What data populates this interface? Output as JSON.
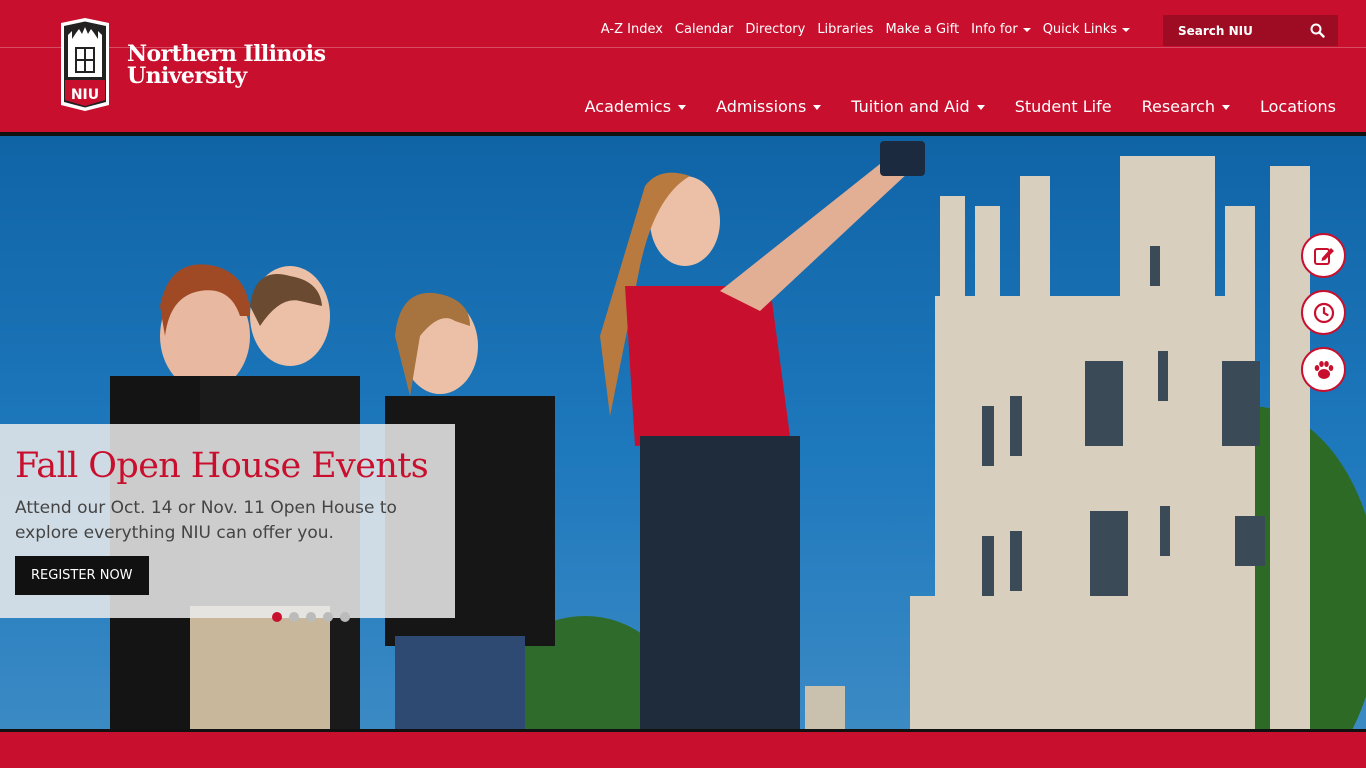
{
  "branding": {
    "shield_text": "NIU",
    "name_line1": "Northern Illinois",
    "name_line2": "University"
  },
  "utility_nav": [
    {
      "label": "A-Z Index"
    },
    {
      "label": "Calendar"
    },
    {
      "label": "Directory"
    },
    {
      "label": "Libraries"
    },
    {
      "label": "Make a Gift"
    },
    {
      "label": "Info for",
      "dropdown": true
    },
    {
      "label": "Quick Links",
      "dropdown": true
    }
  ],
  "search": {
    "label": "Search NIU"
  },
  "main_nav": [
    {
      "label": "Academics",
      "dropdown": true
    },
    {
      "label": "Admissions",
      "dropdown": true
    },
    {
      "label": "Tuition and Aid",
      "dropdown": true
    },
    {
      "label": "Student Life",
      "dropdown": false
    },
    {
      "label": "Research",
      "dropdown": true
    },
    {
      "label": "Locations",
      "dropdown": false
    }
  ],
  "hero": {
    "title": "Fall Open House Events",
    "text": "Attend our Oct. 14 or Nov. 11 Open House to explore everything NIU can offer you.",
    "button": "REGISTER NOW",
    "slides_total": 5,
    "active_slide": 1
  },
  "side_buttons": [
    {
      "icon": "edit-icon"
    },
    {
      "icon": "clock-icon"
    },
    {
      "icon": "paw-icon"
    }
  ],
  "colors": {
    "brand": "#c8102e",
    "dark_brand": "#9e0c23",
    "black": "#111111"
  }
}
